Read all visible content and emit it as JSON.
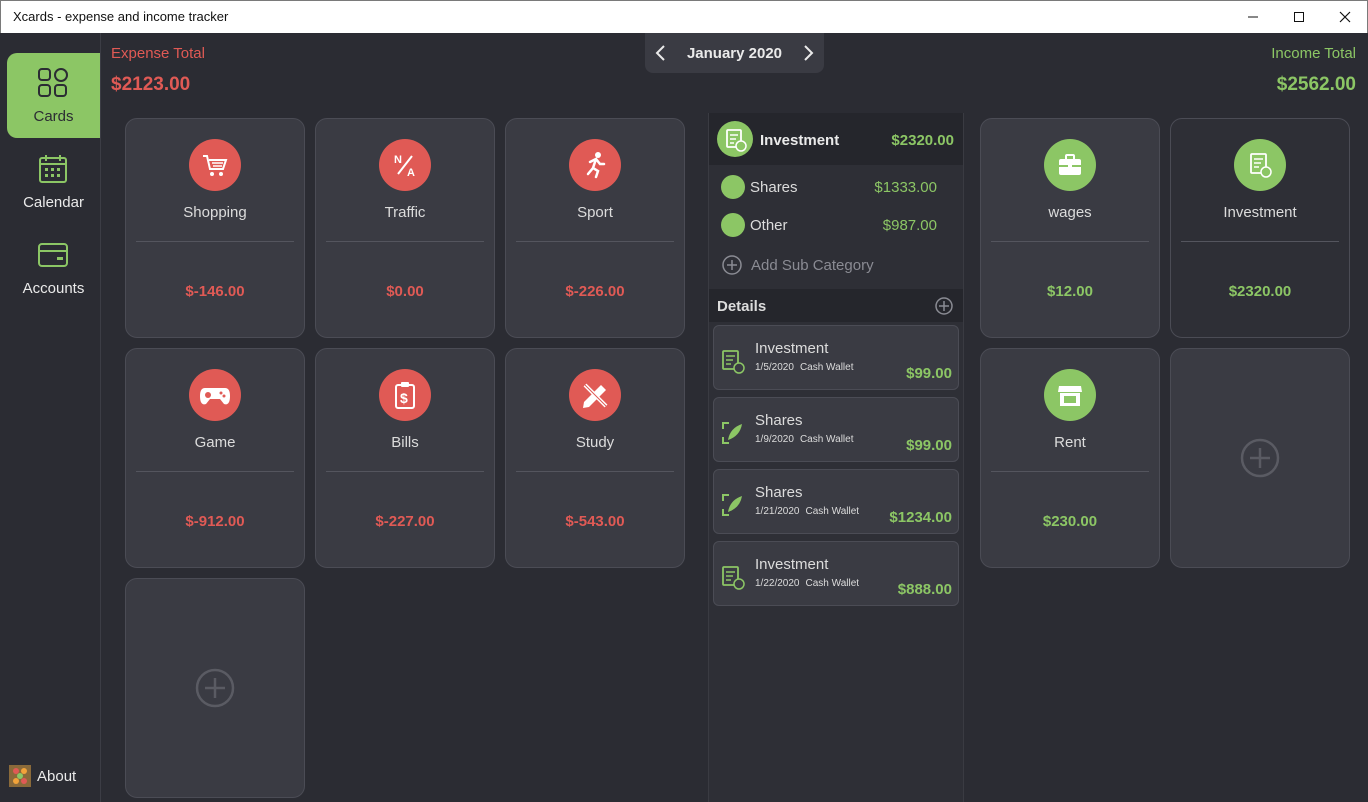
{
  "window": {
    "title": "Xcards - expense and income tracker"
  },
  "sidebar": {
    "items": [
      {
        "label": "Cards"
      },
      {
        "label": "Calendar"
      },
      {
        "label": "Accounts"
      }
    ],
    "about_label": "About"
  },
  "header": {
    "expense_label": "Expense Total",
    "expense_value": "$2123.00",
    "income_label": "Income Total",
    "income_value": "$2562.00",
    "month": "January 2020"
  },
  "expense_cards": [
    {
      "name": "Shopping",
      "amount": "$-146.00",
      "icon": "shopping-cart-icon"
    },
    {
      "name": "Traffic",
      "amount": "$0.00",
      "icon": "na-icon"
    },
    {
      "name": "Sport",
      "amount": "$-226.00",
      "icon": "running-icon"
    },
    {
      "name": "Game",
      "amount": "$-912.00",
      "icon": "gamepad-icon"
    },
    {
      "name": "Bills",
      "amount": "$-227.00",
      "icon": "bill-icon"
    },
    {
      "name": "Study",
      "amount": "$-543.00",
      "icon": "pencil-ruler-icon"
    }
  ],
  "income_cards": [
    {
      "name": "wages",
      "amount": "$12.00",
      "icon": "briefcase-icon"
    },
    {
      "name": "Investment",
      "amount": "$2320.00",
      "icon": "investment-icon"
    },
    {
      "name": "Rent",
      "amount": "$230.00",
      "icon": "store-icon"
    }
  ],
  "detail_panel": {
    "category": "Investment",
    "total": "$2320.00",
    "subcategories": [
      {
        "name": "Shares",
        "amount": "$1333.00"
      },
      {
        "name": "Other",
        "amount": "$987.00"
      }
    ],
    "add_sub_label": "Add Sub Category",
    "details_label": "Details",
    "entries": [
      {
        "name": "Investment",
        "date": "1/5/2020",
        "wallet": "Cash Wallet",
        "amount": "$99.00",
        "icon": "investment-icon"
      },
      {
        "name": "Shares",
        "date": "1/9/2020",
        "wallet": "Cash Wallet",
        "amount": "$99.00",
        "icon": "shares-icon"
      },
      {
        "name": "Shares",
        "date": "1/21/2020",
        "wallet": "Cash Wallet",
        "amount": "$1234.00",
        "icon": "shares-icon"
      },
      {
        "name": "Investment",
        "date": "1/22/2020",
        "wallet": "Cash Wallet",
        "amount": "$888.00",
        "icon": "investment-icon"
      }
    ]
  },
  "colors": {
    "expense": "#e05a55",
    "income": "#8cc665",
    "background": "#2b2c33",
    "card": "#3a3b43"
  }
}
